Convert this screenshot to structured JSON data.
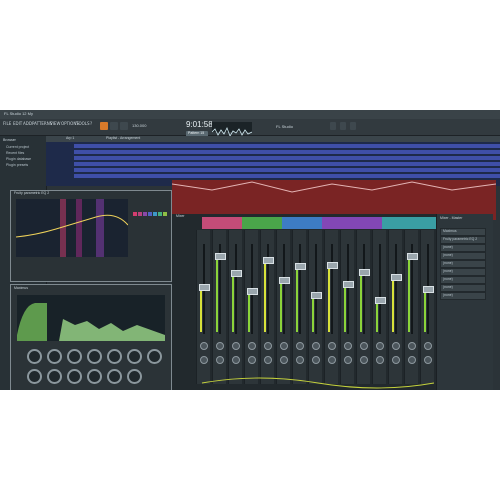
{
  "app": {
    "window_title": "FL Studio 12 My",
    "menu": [
      "FILE",
      "EDIT",
      "ADD",
      "PATTERNS",
      "VIEW",
      "OPTIONS",
      "TOOLS",
      "?"
    ],
    "tempo": "130.000",
    "time_display": "9:01:58",
    "pattern_button": "Pattern 15",
    "tooltip": "FL Studio"
  },
  "browser": {
    "header": "Browser",
    "items": [
      "Current project",
      "Recent files",
      "Plugin database",
      "Plugin presets"
    ]
  },
  "playlist": {
    "title": "Playlist - Arrangement",
    "pattern_label": "Arp 1"
  },
  "mixer": {
    "title": "Mixer",
    "colors": {
      "meter_green": "#8bd43a",
      "meter_yellow": "#d7e13a",
      "automation_red": "#7a2424",
      "playlist_blue": "#3f4fa8"
    }
  },
  "fx_panel": {
    "title": "Mixer - Master",
    "slots": [
      "Maximus",
      "Fruity parametric EQ 2",
      "(none)",
      "(none)",
      "(none)",
      "(none)",
      "(none)",
      "(none)",
      "(none)"
    ]
  },
  "plugins": {
    "eq_title": "Fruity parametric EQ 2",
    "comp_title": "Maximus"
  }
}
